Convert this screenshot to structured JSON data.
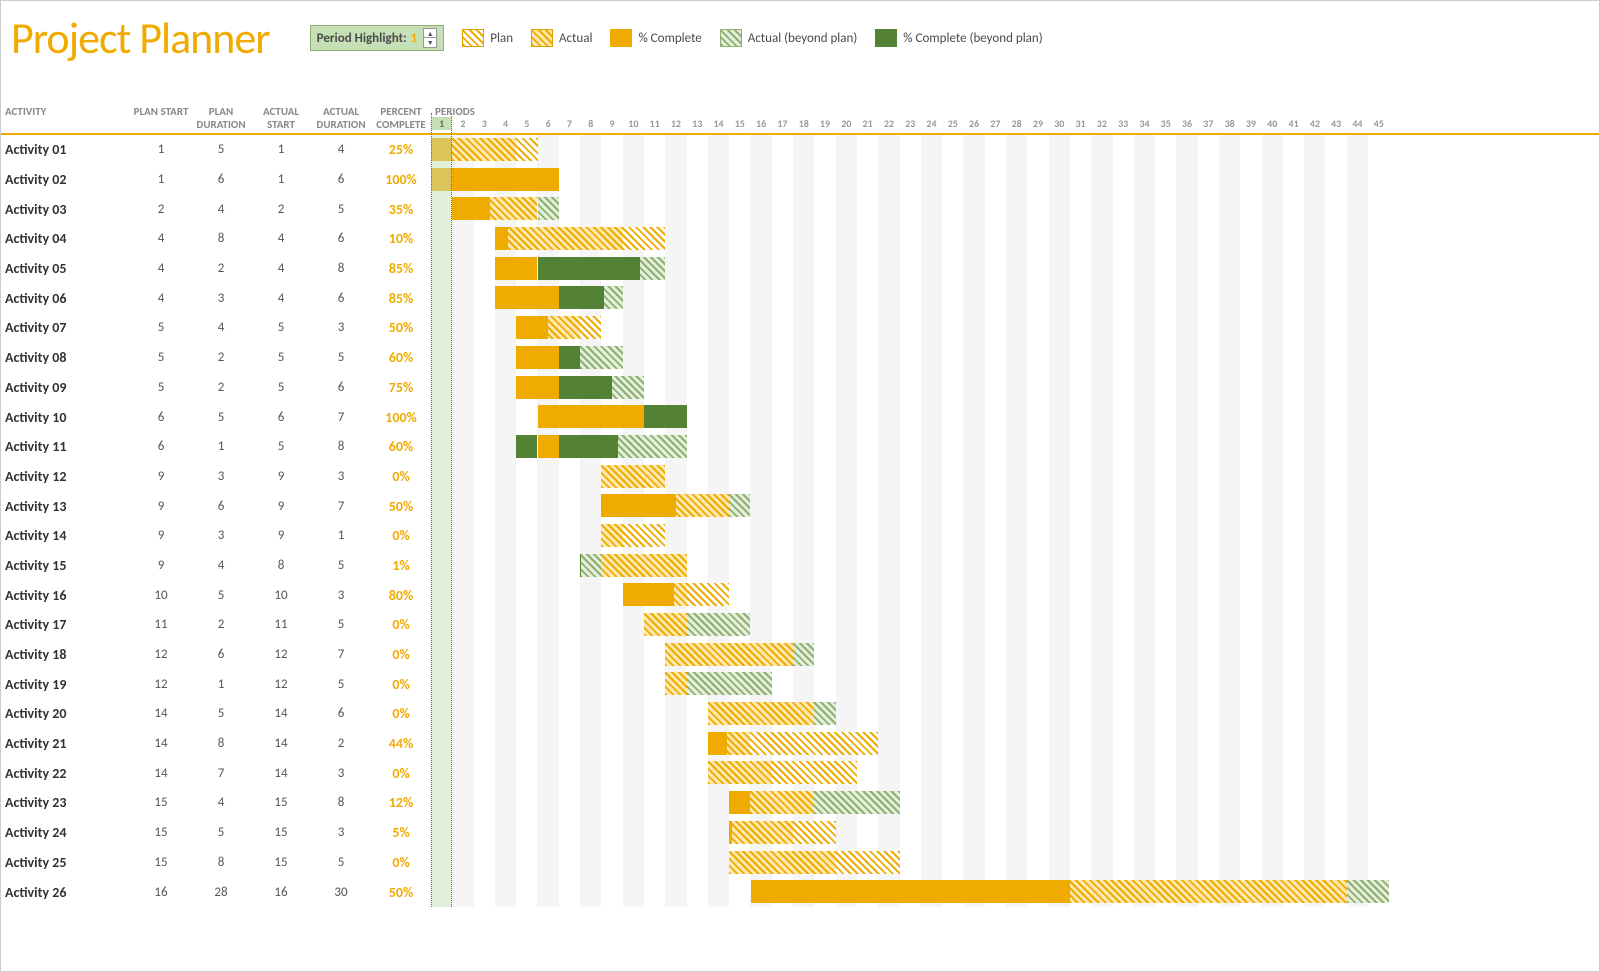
{
  "title": "Project Planner",
  "period_highlight": {
    "label": "Period Highlight:",
    "value": 1
  },
  "legend": {
    "plan": "Plan",
    "actual": "Actual",
    "complete": "% Complete",
    "beyond_actual": "Actual (beyond plan)",
    "beyond_complete": "% Complete (beyond plan)"
  },
  "columns": {
    "activity": "ACTIVITY",
    "plan_start": "PLAN START",
    "plan_duration": "PLAN DURATION",
    "actual_start": "ACTUAL START",
    "actual_duration": "ACTUAL DURATION",
    "percent_complete": "PERCENT COMPLETE",
    "periods": "PERIODS"
  },
  "num_periods": 45,
  "colors": {
    "accent": "#f0ab00",
    "green_dark": "#548235",
    "green_light": "#c5e0b4"
  },
  "chart_data": {
    "type": "bar",
    "title": "Project Planner Gantt",
    "xlabel": "PERIODS",
    "ylabel": "ACTIVITY",
    "xlim": [
      1,
      45
    ],
    "activities": [
      {
        "name": "Activity 01",
        "plan_start": 1,
        "plan_duration": 5,
        "actual_start": 1,
        "actual_duration": 4,
        "percent_complete": 25
      },
      {
        "name": "Activity 02",
        "plan_start": 1,
        "plan_duration": 6,
        "actual_start": 1,
        "actual_duration": 6,
        "percent_complete": 100
      },
      {
        "name": "Activity 03",
        "plan_start": 2,
        "plan_duration": 4,
        "actual_start": 2,
        "actual_duration": 5,
        "percent_complete": 35
      },
      {
        "name": "Activity 04",
        "plan_start": 4,
        "plan_duration": 8,
        "actual_start": 4,
        "actual_duration": 6,
        "percent_complete": 10
      },
      {
        "name": "Activity 05",
        "plan_start": 4,
        "plan_duration": 2,
        "actual_start": 4,
        "actual_duration": 8,
        "percent_complete": 85
      },
      {
        "name": "Activity 06",
        "plan_start": 4,
        "plan_duration": 3,
        "actual_start": 4,
        "actual_duration": 6,
        "percent_complete": 85
      },
      {
        "name": "Activity 07",
        "plan_start": 5,
        "plan_duration": 4,
        "actual_start": 5,
        "actual_duration": 3,
        "percent_complete": 50
      },
      {
        "name": "Activity 08",
        "plan_start": 5,
        "plan_duration": 2,
        "actual_start": 5,
        "actual_duration": 5,
        "percent_complete": 60
      },
      {
        "name": "Activity 09",
        "plan_start": 5,
        "plan_duration": 2,
        "actual_start": 5,
        "actual_duration": 6,
        "percent_complete": 75
      },
      {
        "name": "Activity 10",
        "plan_start": 6,
        "plan_duration": 5,
        "actual_start": 6,
        "actual_duration": 7,
        "percent_complete": 100
      },
      {
        "name": "Activity 11",
        "plan_start": 6,
        "plan_duration": 1,
        "actual_start": 5,
        "actual_duration": 8,
        "percent_complete": 60
      },
      {
        "name": "Activity 12",
        "plan_start": 9,
        "plan_duration": 3,
        "actual_start": 9,
        "actual_duration": 3,
        "percent_complete": 0
      },
      {
        "name": "Activity 13",
        "plan_start": 9,
        "plan_duration": 6,
        "actual_start": 9,
        "actual_duration": 7,
        "percent_complete": 50
      },
      {
        "name": "Activity 14",
        "plan_start": 9,
        "plan_duration": 3,
        "actual_start": 9,
        "actual_duration": 1,
        "percent_complete": 0
      },
      {
        "name": "Activity 15",
        "plan_start": 9,
        "plan_duration": 4,
        "actual_start": 8,
        "actual_duration": 5,
        "percent_complete": 1
      },
      {
        "name": "Activity 16",
        "plan_start": 10,
        "plan_duration": 5,
        "actual_start": 10,
        "actual_duration": 3,
        "percent_complete": 80
      },
      {
        "name": "Activity 17",
        "plan_start": 11,
        "plan_duration": 2,
        "actual_start": 11,
        "actual_duration": 5,
        "percent_complete": 0
      },
      {
        "name": "Activity 18",
        "plan_start": 12,
        "plan_duration": 6,
        "actual_start": 12,
        "actual_duration": 7,
        "percent_complete": 0
      },
      {
        "name": "Activity 19",
        "plan_start": 12,
        "plan_duration": 1,
        "actual_start": 12,
        "actual_duration": 5,
        "percent_complete": 0
      },
      {
        "name": "Activity 20",
        "plan_start": 14,
        "plan_duration": 5,
        "actual_start": 14,
        "actual_duration": 6,
        "percent_complete": 0
      },
      {
        "name": "Activity 21",
        "plan_start": 14,
        "plan_duration": 8,
        "actual_start": 14,
        "actual_duration": 2,
        "percent_complete": 44
      },
      {
        "name": "Activity 22",
        "plan_start": 14,
        "plan_duration": 7,
        "actual_start": 14,
        "actual_duration": 3,
        "percent_complete": 0
      },
      {
        "name": "Activity 23",
        "plan_start": 15,
        "plan_duration": 4,
        "actual_start": 15,
        "actual_duration": 8,
        "percent_complete": 12
      },
      {
        "name": "Activity 24",
        "plan_start": 15,
        "plan_duration": 5,
        "actual_start": 15,
        "actual_duration": 3,
        "percent_complete": 5
      },
      {
        "name": "Activity 25",
        "plan_start": 15,
        "plan_duration": 8,
        "actual_start": 15,
        "actual_duration": 5,
        "percent_complete": 0
      },
      {
        "name": "Activity 26",
        "plan_start": 16,
        "plan_duration": 28,
        "actual_start": 16,
        "actual_duration": 30,
        "percent_complete": 50
      }
    ]
  }
}
